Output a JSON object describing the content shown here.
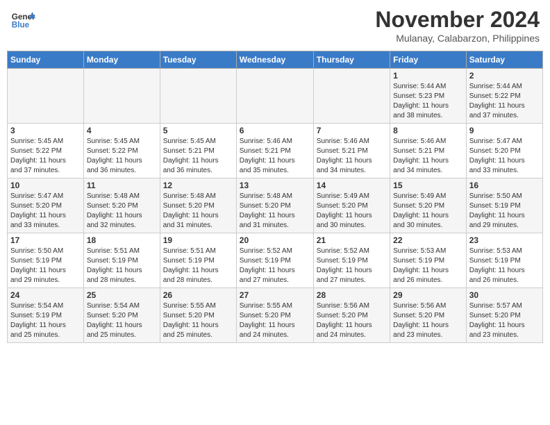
{
  "header": {
    "logo_line1": "General",
    "logo_line2": "Blue",
    "month_title": "November 2024",
    "location": "Mulanay, Calabarzon, Philippines"
  },
  "weekdays": [
    "Sunday",
    "Monday",
    "Tuesday",
    "Wednesday",
    "Thursday",
    "Friday",
    "Saturday"
  ],
  "weeks": [
    [
      {
        "day": "",
        "info": ""
      },
      {
        "day": "",
        "info": ""
      },
      {
        "day": "",
        "info": ""
      },
      {
        "day": "",
        "info": ""
      },
      {
        "day": "",
        "info": ""
      },
      {
        "day": "1",
        "info": "Sunrise: 5:44 AM\nSunset: 5:23 PM\nDaylight: 11 hours\nand 38 minutes."
      },
      {
        "day": "2",
        "info": "Sunrise: 5:44 AM\nSunset: 5:22 PM\nDaylight: 11 hours\nand 37 minutes."
      }
    ],
    [
      {
        "day": "3",
        "info": "Sunrise: 5:45 AM\nSunset: 5:22 PM\nDaylight: 11 hours\nand 37 minutes."
      },
      {
        "day": "4",
        "info": "Sunrise: 5:45 AM\nSunset: 5:22 PM\nDaylight: 11 hours\nand 36 minutes."
      },
      {
        "day": "5",
        "info": "Sunrise: 5:45 AM\nSunset: 5:21 PM\nDaylight: 11 hours\nand 36 minutes."
      },
      {
        "day": "6",
        "info": "Sunrise: 5:46 AM\nSunset: 5:21 PM\nDaylight: 11 hours\nand 35 minutes."
      },
      {
        "day": "7",
        "info": "Sunrise: 5:46 AM\nSunset: 5:21 PM\nDaylight: 11 hours\nand 34 minutes."
      },
      {
        "day": "8",
        "info": "Sunrise: 5:46 AM\nSunset: 5:21 PM\nDaylight: 11 hours\nand 34 minutes."
      },
      {
        "day": "9",
        "info": "Sunrise: 5:47 AM\nSunset: 5:20 PM\nDaylight: 11 hours\nand 33 minutes."
      }
    ],
    [
      {
        "day": "10",
        "info": "Sunrise: 5:47 AM\nSunset: 5:20 PM\nDaylight: 11 hours\nand 33 minutes."
      },
      {
        "day": "11",
        "info": "Sunrise: 5:48 AM\nSunset: 5:20 PM\nDaylight: 11 hours\nand 32 minutes."
      },
      {
        "day": "12",
        "info": "Sunrise: 5:48 AM\nSunset: 5:20 PM\nDaylight: 11 hours\nand 31 minutes."
      },
      {
        "day": "13",
        "info": "Sunrise: 5:48 AM\nSunset: 5:20 PM\nDaylight: 11 hours\nand 31 minutes."
      },
      {
        "day": "14",
        "info": "Sunrise: 5:49 AM\nSunset: 5:20 PM\nDaylight: 11 hours\nand 30 minutes."
      },
      {
        "day": "15",
        "info": "Sunrise: 5:49 AM\nSunset: 5:20 PM\nDaylight: 11 hours\nand 30 minutes."
      },
      {
        "day": "16",
        "info": "Sunrise: 5:50 AM\nSunset: 5:19 PM\nDaylight: 11 hours\nand 29 minutes."
      }
    ],
    [
      {
        "day": "17",
        "info": "Sunrise: 5:50 AM\nSunset: 5:19 PM\nDaylight: 11 hours\nand 29 minutes."
      },
      {
        "day": "18",
        "info": "Sunrise: 5:51 AM\nSunset: 5:19 PM\nDaylight: 11 hours\nand 28 minutes."
      },
      {
        "day": "19",
        "info": "Sunrise: 5:51 AM\nSunset: 5:19 PM\nDaylight: 11 hours\nand 28 minutes."
      },
      {
        "day": "20",
        "info": "Sunrise: 5:52 AM\nSunset: 5:19 PM\nDaylight: 11 hours\nand 27 minutes."
      },
      {
        "day": "21",
        "info": "Sunrise: 5:52 AM\nSunset: 5:19 PM\nDaylight: 11 hours\nand 27 minutes."
      },
      {
        "day": "22",
        "info": "Sunrise: 5:53 AM\nSunset: 5:19 PM\nDaylight: 11 hours\nand 26 minutes."
      },
      {
        "day": "23",
        "info": "Sunrise: 5:53 AM\nSunset: 5:19 PM\nDaylight: 11 hours\nand 26 minutes."
      }
    ],
    [
      {
        "day": "24",
        "info": "Sunrise: 5:54 AM\nSunset: 5:19 PM\nDaylight: 11 hours\nand 25 minutes."
      },
      {
        "day": "25",
        "info": "Sunrise: 5:54 AM\nSunset: 5:20 PM\nDaylight: 11 hours\nand 25 minutes."
      },
      {
        "day": "26",
        "info": "Sunrise: 5:55 AM\nSunset: 5:20 PM\nDaylight: 11 hours\nand 25 minutes."
      },
      {
        "day": "27",
        "info": "Sunrise: 5:55 AM\nSunset: 5:20 PM\nDaylight: 11 hours\nand 24 minutes."
      },
      {
        "day": "28",
        "info": "Sunrise: 5:56 AM\nSunset: 5:20 PM\nDaylight: 11 hours\nand 24 minutes."
      },
      {
        "day": "29",
        "info": "Sunrise: 5:56 AM\nSunset: 5:20 PM\nDaylight: 11 hours\nand 23 minutes."
      },
      {
        "day": "30",
        "info": "Sunrise: 5:57 AM\nSunset: 5:20 PM\nDaylight: 11 hours\nand 23 minutes."
      }
    ]
  ]
}
